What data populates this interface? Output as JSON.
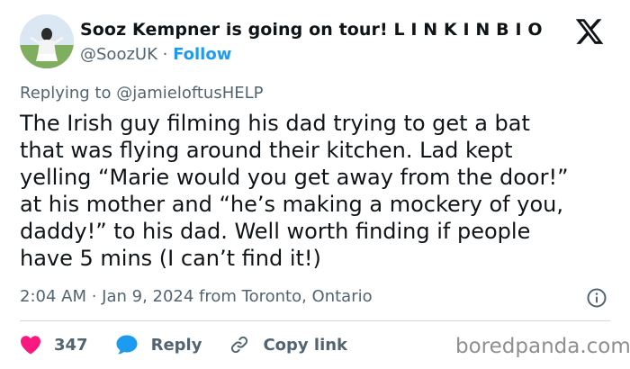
{
  "author": {
    "display_name": "Sooz Kempner is going on tour! L I N K I N B I O",
    "handle": "@SoozUK",
    "separator": " · ",
    "follow_label": "Follow"
  },
  "reply": {
    "prefix": "Replying to ",
    "mention": "@jamieloftusHELP"
  },
  "tweet": {
    "text": "The Irish guy filming his dad trying to get a bat\nthat was flying around their kitchen. Lad kept\nyelling “Marie would you get away from the door!”\nat his mother and “he’s making a mockery of you,\ndaddy!” to his dad. Well worth finding if people\nhave 5 mins (I can’t find it!)",
    "timestamp": "2:04 AM · Jan 9, 2024 from Toronto, Ontario"
  },
  "actions": {
    "like_count": "347",
    "reply_label": "Reply",
    "copy_link_label": "Copy link"
  },
  "watermark": "boredpanda.com",
  "colors": {
    "like": "#f91880",
    "reply": "#1d9bf0",
    "link": "#1d9bf0",
    "muted": "#536471",
    "text": "#0f1419"
  },
  "icons": [
    "avatar",
    "x-logo-icon",
    "info-icon",
    "heart-icon",
    "reply-bubble-icon",
    "link-icon"
  ]
}
